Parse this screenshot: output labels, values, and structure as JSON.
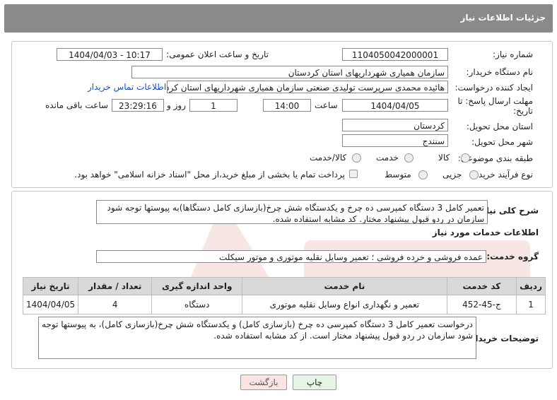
{
  "header": {
    "title": "جزئیات اطلاعات نیاز"
  },
  "form": {
    "need_number_label": "شماره نیاز:",
    "need_number": "1104050042000001",
    "announce_label": "تاریخ و ساعت اعلان عمومی:",
    "announce_value": "1404/04/03 - 10:17",
    "buyer_org_label": "نام دستگاه خریدار:",
    "buyer_org": "سازمان همیاری شهرداریهای استان کردستان",
    "creator_label": "ایجاد کننده درخواست:",
    "creator": "هائیده محمدی سرپرست تولیدی صنعتی سازمان همیاری شهرداریهای استان کردستان",
    "contact_link": "اطلاعات تماس خریدار",
    "deadline_label_1": "مهلت ارسال پاسخ: تا",
    "deadline_label_2": "تاریخ:",
    "deadline_date": "1404/04/05",
    "time_label": "ساعت",
    "deadline_time": "14:00",
    "days_value": "1",
    "days_label": "روز و",
    "remaining_time": "23:29:16",
    "remaining_label": "ساعت باقی مانده",
    "province_label": "استان محل تحویل:",
    "province": "کردستان",
    "city_label": "شهر محل تحویل:",
    "city": "سنندج",
    "category_label": "طبقه بندی موضوعی:",
    "category_options": [
      "کالا",
      "خدمت",
      "کالا/خدمت"
    ],
    "process_label": "نوع فرآیند خرید :",
    "process_options": [
      "جزیی",
      "متوسط"
    ],
    "payment_note": "پرداخت تمام یا بخشی از مبلغ خرید،از محل \"اسناد خزانه اسلامی\" خواهد بود."
  },
  "summary": {
    "label": "شرح کلی نیاز:",
    "text": "تعمیر کامل 3 دستگاه کمپرسی ده چرخ و یکدستگاه شش چرخ(بازسازی کامل دستگاها)به پیوستها توجه شود سازمان در ردو قبول پیشنهاد مختار. کد مشابه استفاده شده."
  },
  "services": {
    "section_title": "اطلاعات خدمات مورد نیاز",
    "group_label": "گروه خدمت:",
    "group_value": "عمده فروشی و خرده فروشی ؛ تعمیر وسایل نقلیه موتوری و موتور سیکلت",
    "columns": [
      "ردیف",
      "کد خدمت",
      "نام خدمت",
      "واحد اندازه گیری",
      "تعداد / مقدار",
      "تاریخ نیاز"
    ],
    "rows": [
      [
        "1",
        "ج-45-452",
        "تعمیر و نگهداری انواع وسایل نقلیه موتوری",
        "دستگاه",
        "4",
        "1404/04/05"
      ]
    ]
  },
  "buyer_notes": {
    "label": "توضیحات خریدار:",
    "text": "درخواست تعمیر کامل 3 دستگاه کمپرسی ده چرخ (بازسازی کامل) و یکدستگاه شش چرخ(بازسازی کامل)، به پیوستها توجه شود سازمان در ردو قبول پیشنهاد مختار است. از کد مشابه استفاده شده."
  },
  "buttons": {
    "print": "چاپ",
    "back": "بازگشت"
  },
  "colors": {
    "header_bg": "#8a8a8a",
    "table_header_bg": "#d9d9d9",
    "back_btn_bg": "#fbe4e4",
    "print_btn_bg": "#e6f5e6",
    "link": "#1a4fb8"
  }
}
